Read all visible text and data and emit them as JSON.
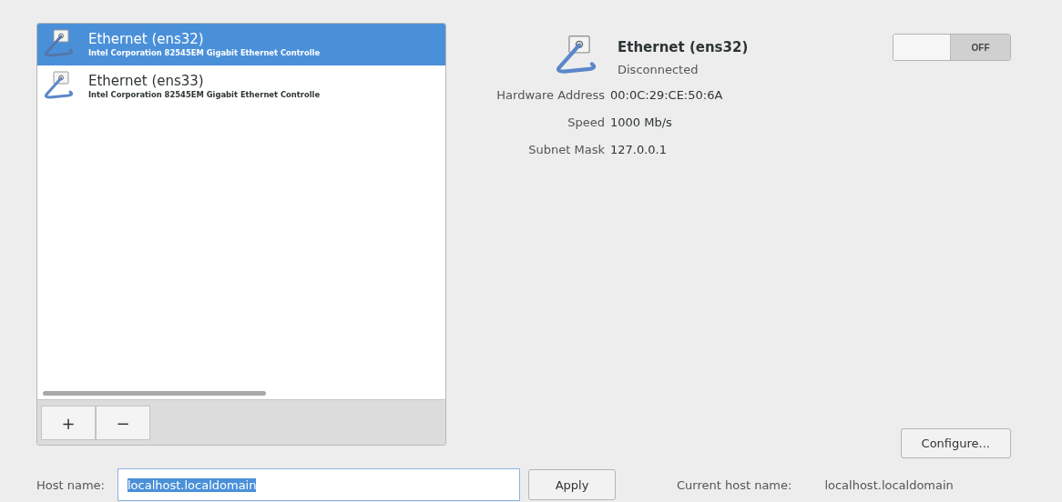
{
  "devices": [
    {
      "name": "Ethernet (ens32)",
      "description": "Intel Corporation 82545EM Gigabit Ethernet Controlle",
      "selected": true
    },
    {
      "name": "Ethernet (ens33)",
      "description": "Intel Corporation 82545EM Gigabit Ethernet Controlle",
      "selected": false
    }
  ],
  "list_toolbar": {
    "buttons": [
      "+",
      "−"
    ]
  },
  "detail": {
    "title": "Ethernet (ens32)",
    "status": "Disconnected",
    "toggle": {
      "label": "OFF",
      "on": false
    },
    "properties": [
      {
        "label": "Hardware Address",
        "value": "00:0C:29:CE:50:6A"
      },
      {
        "label": "Speed",
        "value": "1000 Mb/s"
      },
      {
        "label": "Subnet Mask",
        "value": "127.0.0.1"
      }
    ],
    "configure_button": "Configure..."
  },
  "hostname": {
    "label": "Host name:",
    "value": "localhost.localdomain",
    "text_selected": true,
    "apply_button": "Apply",
    "current_label": "Current host name:",
    "current_value": "localhost.localdomain"
  }
}
